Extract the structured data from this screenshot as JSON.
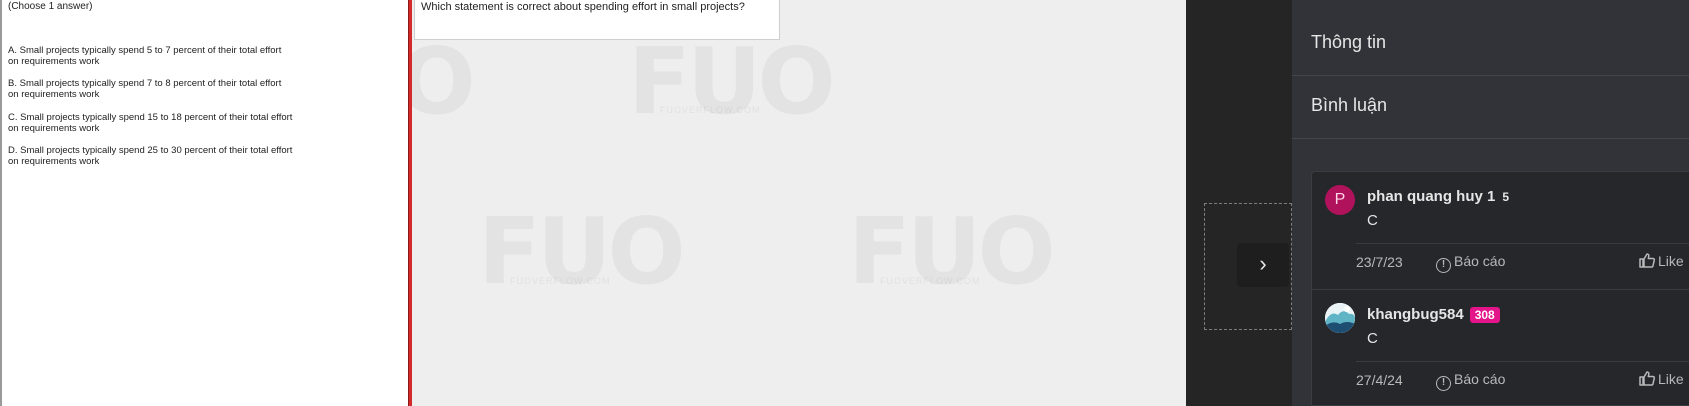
{
  "question": {
    "choose_hint": "(Choose 1 answer)",
    "prompt": "Which statement is correct about spending effort in small projects?",
    "options": [
      {
        "line1": "A.  Small projects typically spend 5 to 7 percent of their total effort",
        "line2": "on requirements work"
      },
      {
        "line1": "B.  Small projects typically spend 7 to 8 percent of their total effort",
        "line2": "on requirements work"
      },
      {
        "line1": "C.  Small projects typically spend 15 to 18 percent of their total effort",
        "line2": "on requirements work"
      },
      {
        "line1": "D.  Small projects typically spend 25 to 30 percent of their total effort",
        "line2": "on requirements work"
      }
    ],
    "watermark": "FUO",
    "watermark_sub": "FUOVERFLOW.COM"
  },
  "nav": {
    "next_icon": "chevron-right-icon",
    "next_glyph": "›"
  },
  "panel": {
    "info_label": "Thông tin",
    "comments_label": "Bình luận"
  },
  "comments": [
    {
      "avatar_letter": "P",
      "user": "phan quang huy 1",
      "level": "5",
      "body": "C",
      "date": "23/7/23",
      "report_label": "Báo cáo",
      "like_label": "Like"
    },
    {
      "avatar_letter": "",
      "user": "khangbug584",
      "level": "308",
      "body": "C",
      "date": "27/4/24",
      "report_label": "Báo cáo",
      "like_label": "Like"
    }
  ],
  "colors": {
    "accent_red": "#d52a2a",
    "badge_pink": "#e4148a",
    "avatar_magenta": "#b0125b",
    "panel_bg": "#323338"
  }
}
